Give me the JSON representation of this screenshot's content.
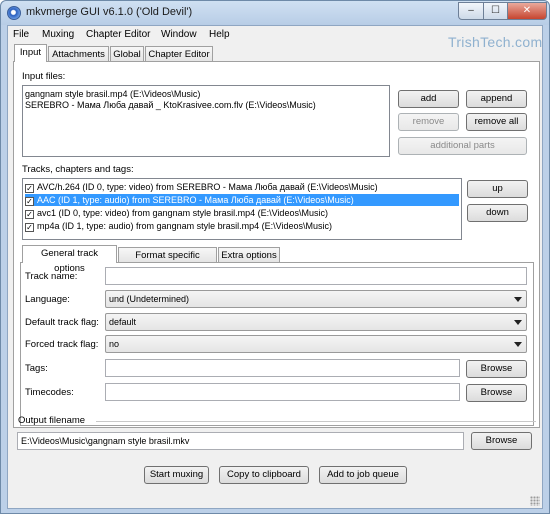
{
  "window": {
    "title": "mkvmerge GUI v6.1.0 ('Old Devil')",
    "controls": {
      "minimize": "‒",
      "maximize": "☐",
      "close": "✕"
    }
  },
  "watermark": "TrishTech.com",
  "menu": [
    {
      "label": "File",
      "mnemonic": "F"
    },
    {
      "label": "Muxing",
      "mnemonic": "M"
    },
    {
      "label": "Chapter Editor",
      "mnemonic": "C"
    },
    {
      "label": "Window",
      "mnemonic": "W"
    },
    {
      "label": "Help",
      "mnemonic": "H"
    }
  ],
  "main_tabs": [
    "Input",
    "Attachments",
    "Global",
    "Chapter Editor"
  ],
  "input_files": {
    "label": "Input files:",
    "files": [
      "gangnam style brasil.mp4 (E:\\Videos\\Music)",
      "SEREBRO - Мама Люба давай _ KtoKrasivee.com.flv (E:\\Videos\\Music)"
    ],
    "buttons": {
      "add": "add",
      "append": "append",
      "remove": "remove",
      "remove_all": "remove all",
      "additional_parts": "additional parts"
    }
  },
  "tracks": {
    "label": "Tracks, chapters and tags:",
    "items": [
      {
        "text": "AVC/h.264 (ID 0, type: video) from SEREBRO - Мама Люба давай (E:\\Videos\\Music)",
        "checked": true,
        "selected": false
      },
      {
        "text": "AAC (ID 1, type: audio) from SEREBRO - Мама Люба давай (E:\\Videos\\Music)",
        "checked": true,
        "selected": true
      },
      {
        "text": "avc1 (ID 0, type: video) from gangnam style brasil.mp4 (E:\\Videos\\Music)",
        "checked": true,
        "selected": false
      },
      {
        "text": "mp4a (ID 1, type: audio) from gangnam style brasil.mp4 (E:\\Videos\\Music)",
        "checked": true,
        "selected": false
      }
    ],
    "buttons": {
      "up": "up",
      "down": "down"
    }
  },
  "sub_tabs": [
    "General track options",
    "Format specific options",
    "Extra options"
  ],
  "options": {
    "track_name": {
      "label": "Track name:",
      "value": ""
    },
    "language": {
      "label": "Language:",
      "value": "und (Undetermined)"
    },
    "default_track_flag": {
      "label": "Default track flag:",
      "value": "default"
    },
    "forced_track_flag": {
      "label": "Forced track flag:",
      "value": "no"
    },
    "tags": {
      "label": "Tags:",
      "value": "",
      "browse": "Browse"
    },
    "timecodes": {
      "label": "Timecodes:",
      "value": "",
      "browse": "Browse"
    }
  },
  "output": {
    "label": "Output filename",
    "value": "E:\\Videos\\Music\\gangnam style brasil.mkv",
    "browse": "Browse"
  },
  "actions": {
    "start_muxing": "Start muxing",
    "copy_to_clipboard": "Copy to clipboard",
    "add_to_job_queue": "Add to job queue"
  }
}
